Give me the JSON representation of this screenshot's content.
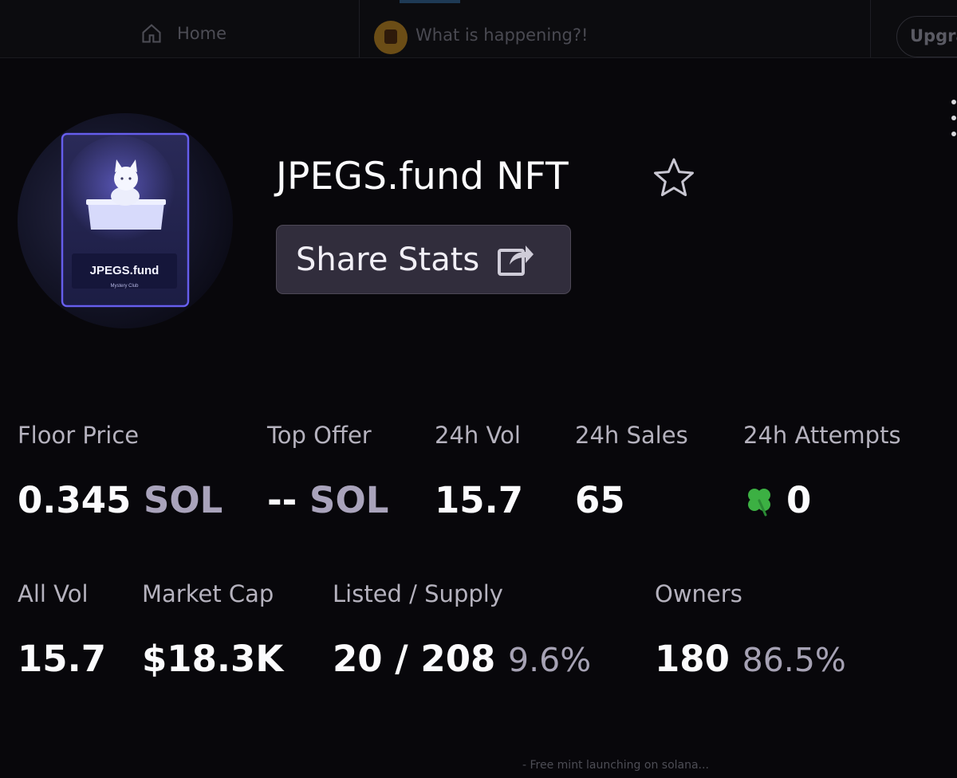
{
  "background_nav": {
    "home_label": "Home",
    "composer_placeholder": "What is happening?!",
    "upgrade_label": "Upgra"
  },
  "collection": {
    "logo_text": "JPEGS.fund",
    "logo_subtext": "Mystery Club",
    "name": "JPEGS.fund NFT",
    "share_label": "Share Stats"
  },
  "stats": {
    "floor_price": {
      "label": "Floor Price",
      "value": "0.345",
      "unit": "SOL"
    },
    "top_offer": {
      "label": "Top Offer",
      "value": "--",
      "unit": "SOL"
    },
    "vol_24h": {
      "label": "24h Vol",
      "value": "15.7"
    },
    "sales_24h": {
      "label": "24h Sales",
      "value": "65"
    },
    "attempts_24h": {
      "label": "24h Attempts",
      "icon": "four-leaf-clover-icon",
      "value": "0"
    },
    "all_vol": {
      "label": "All Vol",
      "value": "15.7"
    },
    "market_cap": {
      "label": "Market Cap",
      "value": "$18.3K"
    },
    "listed_supply": {
      "label": "Listed / Supply",
      "value": "20 / 208",
      "percent": "9.6%"
    },
    "owners": {
      "label": "Owners",
      "value": "180",
      "percent": "86.5%"
    }
  },
  "footer": {
    "text": "- Free mint launching on solana..."
  },
  "colors": {
    "background": "#08070b",
    "button_bg": "#312d3c",
    "muted_unit": "#a9a3bb",
    "clover": "#3cb043"
  }
}
